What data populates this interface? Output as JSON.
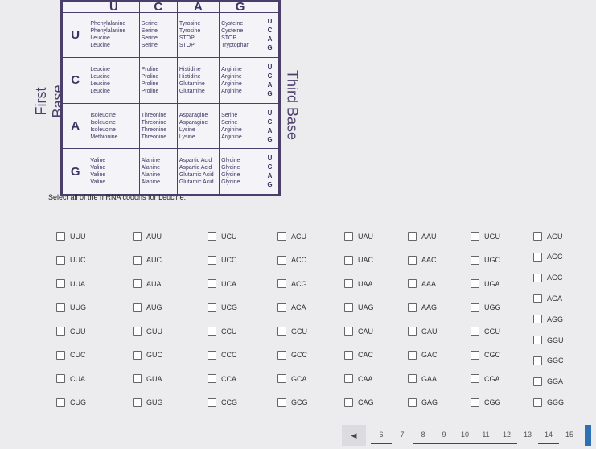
{
  "codon_table": {
    "first_base_label": "First Base",
    "third_base_label": "Third Base",
    "second_bases": [
      "U",
      "C",
      "A",
      "G"
    ],
    "rows": [
      {
        "base": "U",
        "cells": [
          [
            "Phenylalanine",
            "Phenylalanine",
            "Leucine",
            "Leucine"
          ],
          [
            "Serine",
            "Serine",
            "Serine",
            "Serine"
          ],
          [
            "Tyrosine",
            "Tyrosine",
            "STOP",
            "STOP"
          ],
          [
            "Cysteine",
            "Cysteine",
            "STOP",
            "Tryptophan"
          ]
        ]
      },
      {
        "base": "C",
        "cells": [
          [
            "Leucine",
            "Leucine",
            "Leucine",
            "Leucine"
          ],
          [
            "Proline",
            "Proline",
            "Proline",
            "Proline"
          ],
          [
            "Histidine",
            "Histidine",
            "Glutamine",
            "Glutamine"
          ],
          [
            "Arginine",
            "Arginine",
            "Arginine",
            "Arginine"
          ]
        ]
      },
      {
        "base": "A",
        "cells": [
          [
            "Isoleucine",
            "Isoleucine",
            "Isoleucine",
            "Methionine"
          ],
          [
            "Threonine",
            "Threonine",
            "Threonine",
            "Threonine"
          ],
          [
            "Asparagine",
            "Asparagine",
            "Lysine",
            "Lysine"
          ],
          [
            "Serine",
            "Serine",
            "Arginine",
            "Arginine"
          ]
        ]
      },
      {
        "base": "G",
        "cells": [
          [
            "Valine",
            "Valine",
            "Valine",
            "Valine"
          ],
          [
            "Alanine",
            "Alanine",
            "Alanine",
            "Alanine"
          ],
          [
            "Aspartic Acid",
            "Aspartic Acid",
            "Glutamic Acid",
            "Glutamic Acid"
          ],
          [
            "Glycine",
            "Glycine",
            "Glycine",
            "Glycine"
          ]
        ]
      }
    ],
    "third_bases": [
      "U",
      "C",
      "A",
      "G"
    ]
  },
  "question": {
    "prompt": "Select all of the mRNA codons for Leucine:"
  },
  "options": [
    [
      "UUU",
      "UUC",
      "UUA",
      "UUG",
      "CUU",
      "CUC",
      "CUA",
      "CUG"
    ],
    [
      "AUU",
      "AUC",
      "AUA",
      "AUG",
      "GUU",
      "GUC",
      "GUA",
      "GUG"
    ],
    [
      "UCU",
      "UCC",
      "UCA",
      "UCG",
      "CCU",
      "CCC",
      "CCA",
      "CCG"
    ],
    [
      "ACU",
      "ACC",
      "ACG",
      "ACA",
      "GCU",
      "GCC",
      "GCA",
      "GCG"
    ],
    [
      "UAU",
      "UAC",
      "UAA",
      "UAG",
      "CAU",
      "CAC",
      "CAA",
      "CAG"
    ],
    [
      "AAU",
      "AAC",
      "AAA",
      "AAG",
      "GAU",
      "GAC",
      "GAA",
      "GAG"
    ],
    [
      "UGU",
      "UGC",
      "UGA",
      "UGG",
      "CGU",
      "CGC",
      "CGA",
      "CGG"
    ],
    [
      "AGU",
      "AGC",
      "AGC",
      "AGA",
      "AGG",
      "GGU",
      "GGC",
      "GGA",
      "GGG"
    ]
  ],
  "pagination": {
    "prev_icon": "left-triangle",
    "pages": [
      "6",
      "7",
      "8",
      "9",
      "10",
      "11",
      "12",
      "13",
      "14",
      "15"
    ],
    "underlined": [
      "6",
      "8",
      "9",
      "10",
      "11",
      "12",
      "14"
    ],
    "current": "14"
  }
}
